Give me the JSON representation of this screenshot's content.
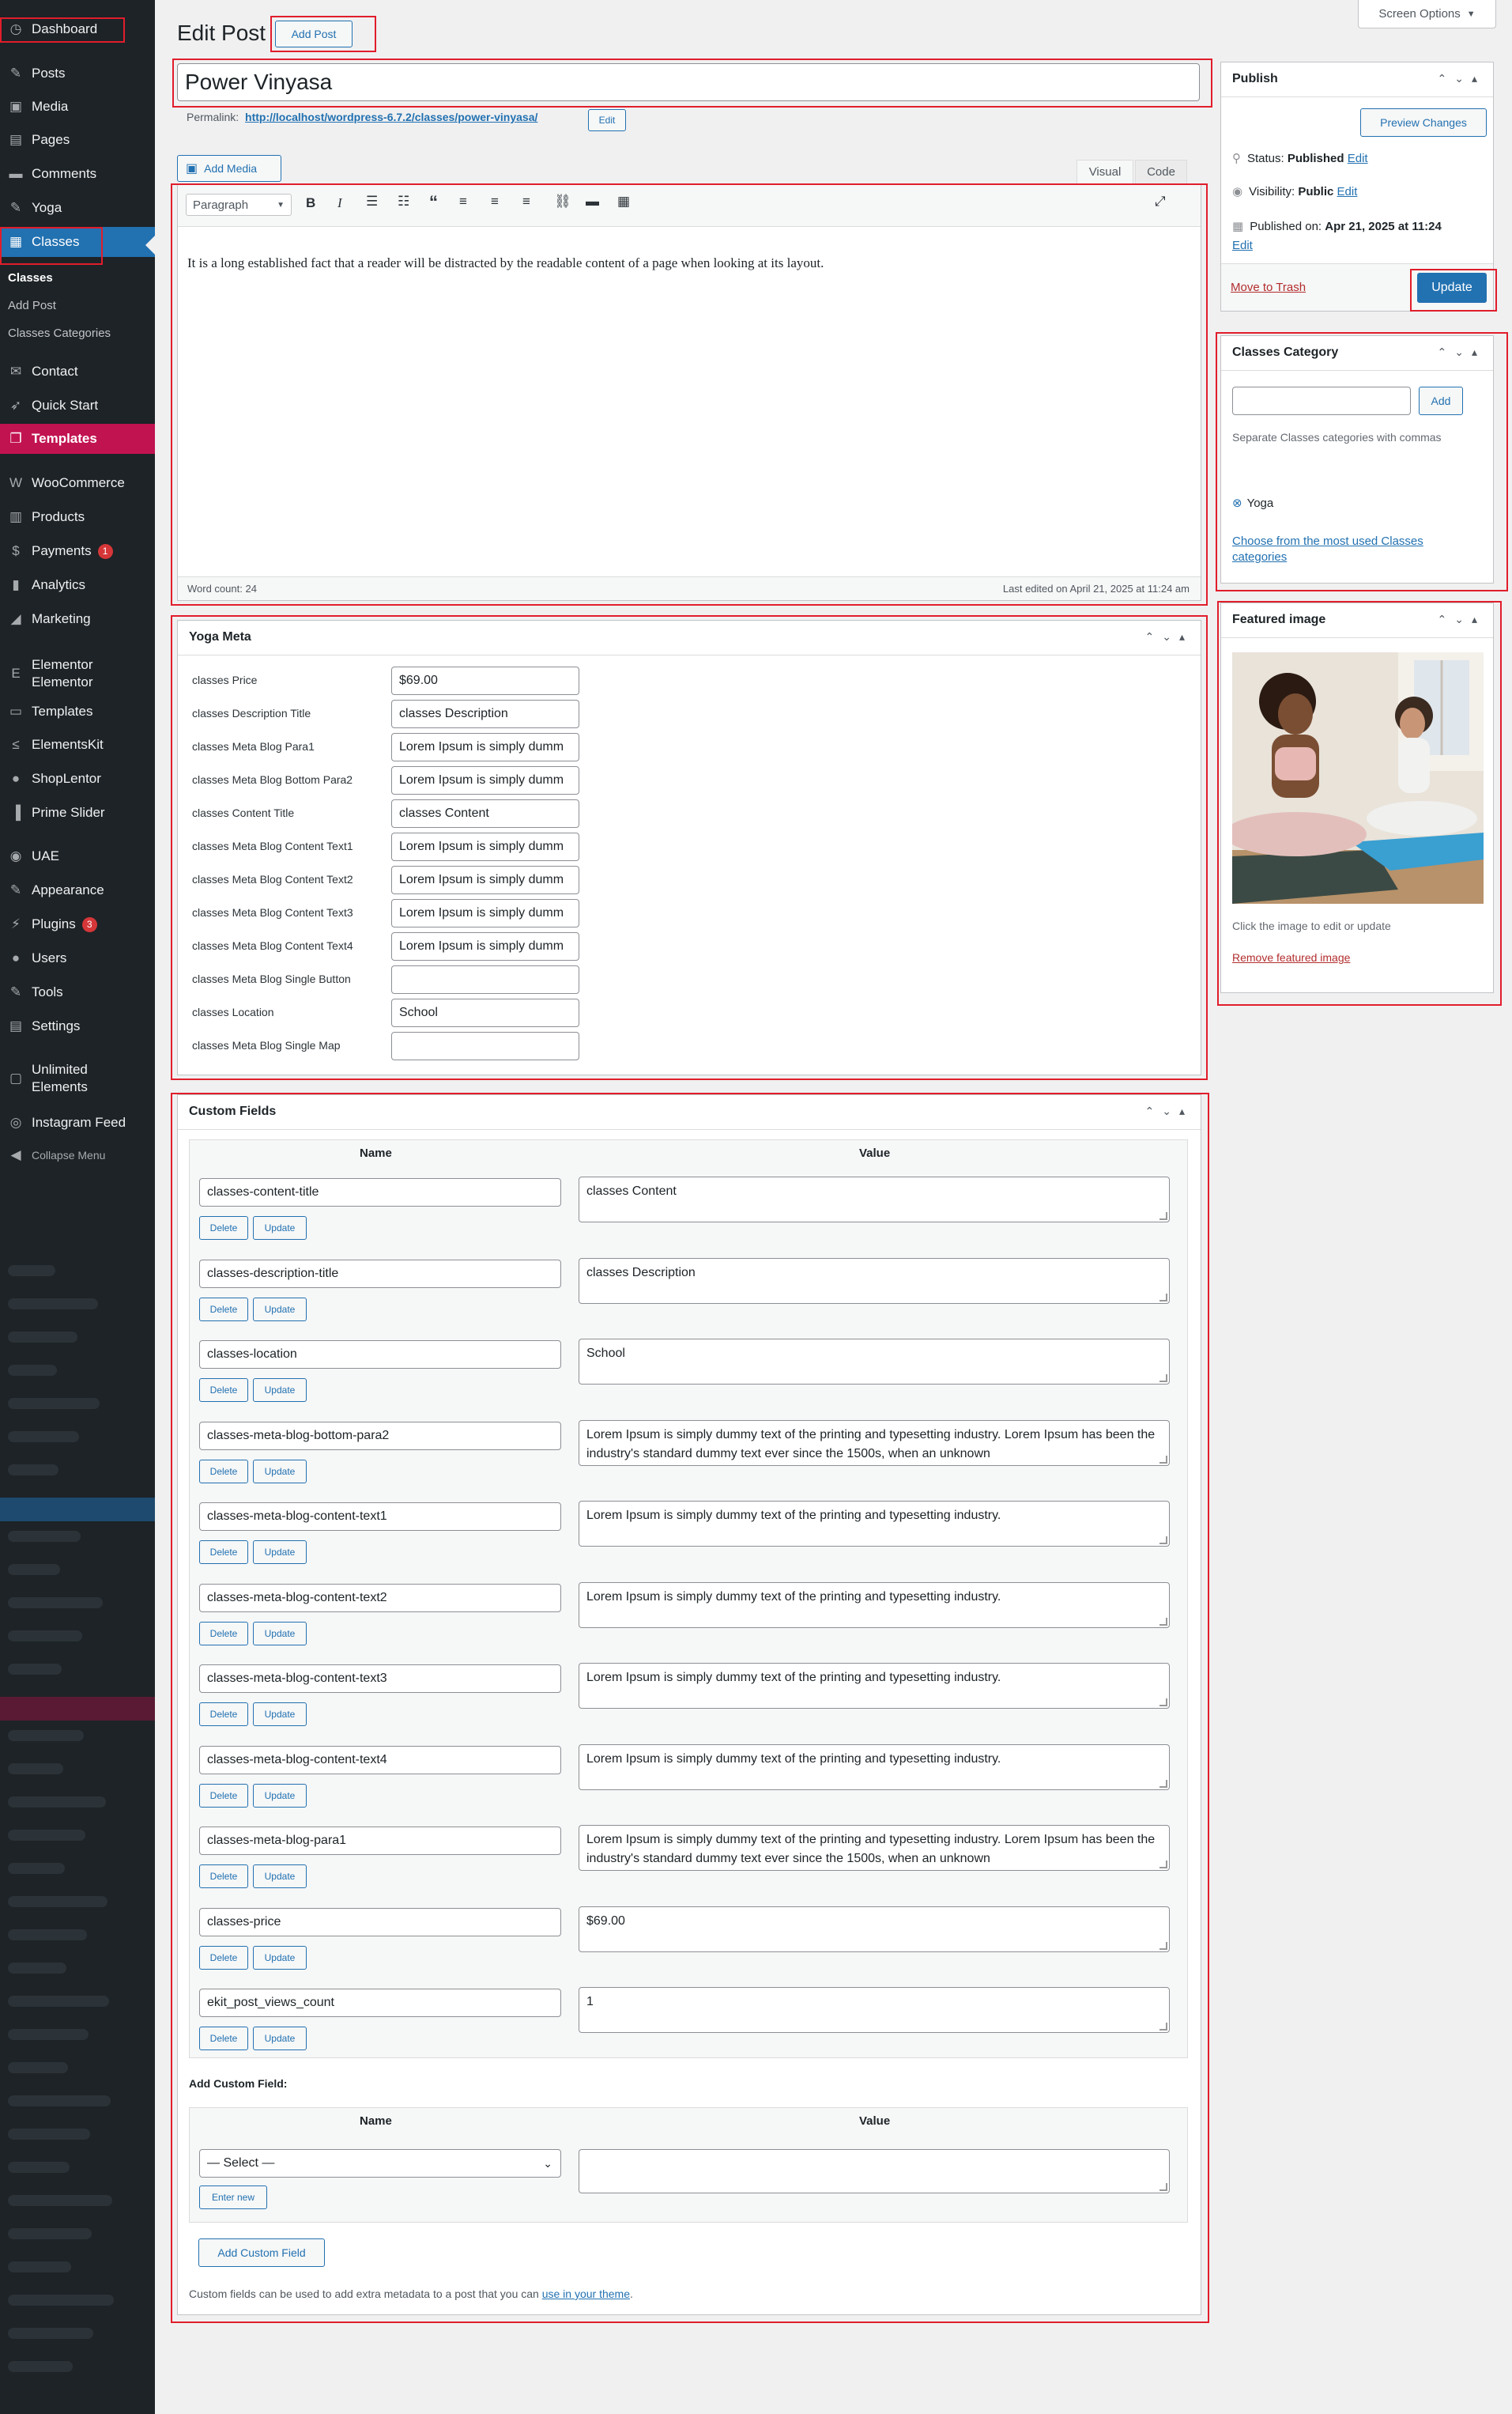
{
  "sidebar": {
    "items": [
      {
        "id": "dashboard",
        "label": "Dashboard",
        "icon": "dashboard-icon",
        "glyph": "◷"
      },
      {
        "id": "posts",
        "label": "Posts",
        "icon": "pin-icon",
        "glyph": "✎"
      },
      {
        "id": "media",
        "label": "Media",
        "icon": "media-icon",
        "glyph": "▣"
      },
      {
        "id": "pages",
        "label": "Pages",
        "icon": "pages-icon",
        "glyph": "▤"
      },
      {
        "id": "comments",
        "label": "Comments",
        "icon": "comments-icon",
        "glyph": "▬"
      },
      {
        "id": "yoga",
        "label": "Yoga",
        "icon": "pin-icon",
        "glyph": "✎"
      },
      {
        "id": "classes",
        "label": "Classes",
        "icon": "classes-icon",
        "glyph": "▦"
      },
      {
        "id": "contact",
        "label": "Contact",
        "icon": "mail-icon",
        "glyph": "✉"
      },
      {
        "id": "quick-start",
        "label": "Quick Start",
        "icon": "rocket-icon",
        "glyph": "➶"
      },
      {
        "id": "templates-top",
        "label": "Templates",
        "icon": "templates-icon",
        "glyph": "❐"
      },
      {
        "id": "woocommerce",
        "label": "WooCommerce",
        "icon": "woo-icon",
        "glyph": "W"
      },
      {
        "id": "products",
        "label": "Products",
        "icon": "products-icon",
        "glyph": "▥"
      },
      {
        "id": "payments",
        "label": "Payments",
        "icon": "payments-icon",
        "glyph": "$",
        "badge": "1"
      },
      {
        "id": "analytics",
        "label": "Analytics",
        "icon": "analytics-icon",
        "glyph": "▮"
      },
      {
        "id": "marketing",
        "label": "Marketing",
        "icon": "megaphone-icon",
        "glyph": "◢"
      },
      {
        "id": "elementor",
        "label": "Elementor",
        "label2": "Elementor",
        "icon": "elementor-icon",
        "glyph": "E"
      },
      {
        "id": "templates",
        "label": "Templates",
        "icon": "folder-icon",
        "glyph": "▭"
      },
      {
        "id": "elementskit",
        "label": "ElementsKit",
        "icon": "elementskit-icon",
        "glyph": "≤"
      },
      {
        "id": "shoplentor",
        "label": "ShopLentor",
        "icon": "shoplentor-icon",
        "glyph": "●"
      },
      {
        "id": "prime-slider",
        "label": "Prime Slider",
        "icon": "slider-icon",
        "glyph": "▐"
      },
      {
        "id": "uae",
        "label": "UAE",
        "icon": "uae-icon",
        "glyph": "◉"
      },
      {
        "id": "appearance",
        "label": "Appearance",
        "icon": "brush-icon",
        "glyph": "✎"
      },
      {
        "id": "plugins",
        "label": "Plugins",
        "icon": "plugin-icon",
        "glyph": "⚡",
        "badge": "3"
      },
      {
        "id": "users",
        "label": "Users",
        "icon": "user-icon",
        "glyph": "●"
      },
      {
        "id": "tools",
        "label": "Tools",
        "icon": "wrench-icon",
        "glyph": "✎"
      },
      {
        "id": "settings",
        "label": "Settings",
        "icon": "settings-icon",
        "glyph": "▤"
      },
      {
        "id": "unlimited",
        "label": "Unlimited",
        "label2": "Elements",
        "icon": "unlimited-icon",
        "glyph": "▢"
      },
      {
        "id": "instagram",
        "label": "Instagram Feed",
        "icon": "instagram-icon",
        "glyph": "◎"
      },
      {
        "id": "collapse",
        "label": "Collapse Menu",
        "icon": "collapse-icon",
        "glyph": "◀"
      }
    ],
    "classes_submenu": [
      "Classes",
      "Add Post",
      "Classes Categories"
    ]
  },
  "header": {
    "title": "Edit Post",
    "add_post": "Add Post",
    "screen_options": "Screen Options"
  },
  "post": {
    "title": "Power Vinyasa",
    "permalink_label": "Permalink:",
    "permalink_url": "http://localhost/wordpress-6.7.2/classes/power-vinyasa/",
    "permalink_edit": "Edit"
  },
  "editor": {
    "add_media": "Add Media",
    "tab_visual": "Visual",
    "tab_code": "Code",
    "format": "Paragraph",
    "content": "It is a long established fact that a reader will be distracted by the readable content of a page when looking at its layout.",
    "word_count": "Word count: 24",
    "last_edited": "Last edited on April 21, 2025 at 11:24 am"
  },
  "yoga_meta": {
    "title": "Yoga Meta",
    "fields": [
      {
        "label": "classes Price",
        "value": "$69.00"
      },
      {
        "label": "classes Description Title",
        "value": "classes Description"
      },
      {
        "label": "classes Meta Blog Para1",
        "value": "Lorem Ipsum is simply dumm"
      },
      {
        "label": "classes Meta Blog Bottom Para2",
        "value": "Lorem Ipsum is simply dumm"
      },
      {
        "label": "classes Content Title",
        "value": "classes Content"
      },
      {
        "label": "classes Meta Blog Content Text1",
        "value": "Lorem Ipsum is simply dumm"
      },
      {
        "label": "classes Meta Blog Content Text2",
        "value": "Lorem Ipsum is simply dumm"
      },
      {
        "label": "classes Meta Blog Content Text3",
        "value": "Lorem Ipsum is simply dumm"
      },
      {
        "label": "classes Meta Blog Content Text4",
        "value": "Lorem Ipsum is simply dumm"
      },
      {
        "label": "classes Meta Blog Single Button",
        "value": ""
      },
      {
        "label": "classes Location",
        "value": "School"
      },
      {
        "label": "classes Meta Blog Single Map",
        "value": ""
      }
    ]
  },
  "custom_fields": {
    "title": "Custom Fields",
    "col_name": "Name",
    "col_value": "Value",
    "delete": "Delete",
    "update": "Update",
    "rows": [
      {
        "name": "classes-content-title",
        "value": "classes Content"
      },
      {
        "name": "classes-description-title",
        "value": "classes Description"
      },
      {
        "name": "classes-location",
        "value": "School"
      },
      {
        "name": "classes-meta-blog-bottom-para2",
        "value": "Lorem Ipsum is simply dummy text of the printing and typesetting industry. Lorem Ipsum has been the industry's standard dummy text ever since the 1500s, when an unknown"
      },
      {
        "name": "classes-meta-blog-content-text1",
        "value": "Lorem Ipsum is simply dummy text of the printing and typesetting industry."
      },
      {
        "name": "classes-meta-blog-content-text2",
        "value": "Lorem Ipsum is simply dummy text of the printing and typesetting industry."
      },
      {
        "name": "classes-meta-blog-content-text3",
        "value": "Lorem Ipsum is simply dummy text of the printing and typesetting industry."
      },
      {
        "name": "classes-meta-blog-content-text4",
        "value": "Lorem Ipsum is simply dummy text of the printing and typesetting industry."
      },
      {
        "name": "classes-meta-blog-para1",
        "value": "Lorem Ipsum is simply dummy text of the printing and typesetting industry. Lorem Ipsum has been the industry's standard dummy text ever since the 1500s, when an unknown"
      },
      {
        "name": "classes-price",
        "value": "$69.00"
      },
      {
        "name": "ekit_post_views_count",
        "value": "1"
      }
    ],
    "add_label": "Add Custom Field:",
    "select_placeholder": "— Select —",
    "enter_new": "Enter new",
    "add_button": "Add Custom Field",
    "footer_text": "Custom fields can be used to add extra metadata to a post that you can",
    "footer_link": "use in your theme",
    "footer_end": "."
  },
  "publish": {
    "title": "Publish",
    "preview": "Preview Changes",
    "status_label": "Status:",
    "status_value": "Published",
    "visibility_label": "Visibility:",
    "visibility_value": "Public",
    "published_label": "Published on:",
    "published_value": "Apr 21, 2025 at 11:24",
    "edit": "Edit",
    "trash": "Move to Trash",
    "update": "Update"
  },
  "classes_category": {
    "title": "Classes Category",
    "add": "Add",
    "help": "Separate Classes categories with commas",
    "tag": "Yoga",
    "choose": "Choose from the most used Classes categories"
  },
  "featured_image": {
    "title": "Featured image",
    "hint": "Click the image to edit or update",
    "remove": "Remove featured image"
  },
  "colors": {
    "accent": "#2271b1",
    "sidebar": "#1d2327",
    "templates": "#c21351",
    "highlight": "#e11d2b",
    "trash": "#b32d2e"
  }
}
